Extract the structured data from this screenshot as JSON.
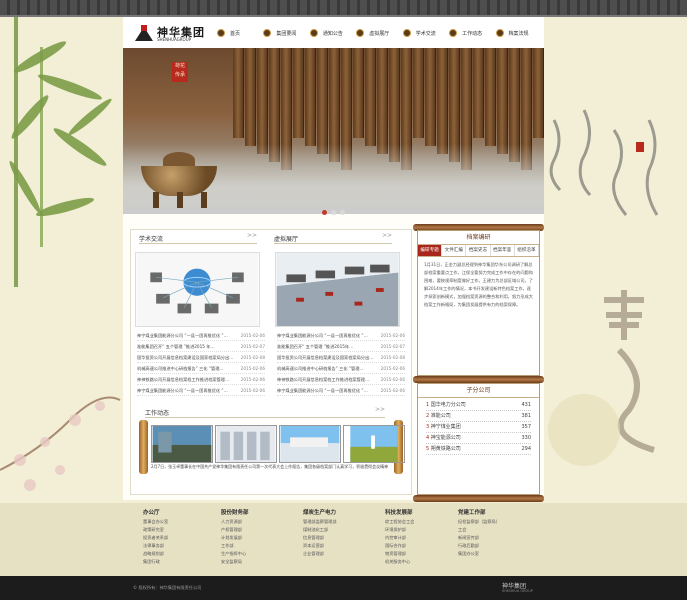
{
  "header": {
    "logo_name": "神华集团",
    "logo_sub": "SHENHUAGROUP",
    "nav": [
      "首页",
      "集团要闻",
      "通知公告",
      "虚拟展厅",
      "学术交流",
      "工作动态",
      "档案法规"
    ]
  },
  "banner": {
    "stamp": "荷花 传承",
    "slider_dots": 3,
    "active_dot": 0
  },
  "academic": {
    "title": "学术交流",
    "more": ">>",
    "items": [
      {
        "text": "神宁煤业集团能源分公司 “一县一团再推优化 ”…",
        "date": "2015-02-06"
      },
      {
        "text": "准能集团召开“ 五个管理 ”推进2015 年…",
        "date": "2015-02-07"
      },
      {
        "text": "国华投资公司开展信息档案建设及国家档案局分出…",
        "date": "2015-02-08"
      },
      {
        "text": "机械高速公司推进中心研档报告” 三化 “管理…",
        "date": "2015-02-06"
      },
      {
        "text": "神神铁路公司开展信息档案档工作推进档案管理…",
        "date": "2015-02-06"
      },
      {
        "text": "神宁煤业集团能源分公司 “一县一团再推优化 ”…",
        "date": "2015-02-06"
      }
    ]
  },
  "virtual": {
    "title": "虚拟展厅",
    "more": ">>",
    "items": [
      {
        "text": "神宁煤业集团能源分公司 “一县一团再推优化 ”…",
        "date": "2015-02-06"
      },
      {
        "text": "准能集团召开“ 五个管理 ”推进2015年…",
        "date": "2015-02-07"
      },
      {
        "text": "国华投资公司开展信息档案建设及国家档案局分出…",
        "date": "2015-02-08"
      },
      {
        "text": "机械高速公司推进中心研档报告” 三化 “管理…",
        "date": "2015-02-06"
      },
      {
        "text": "神神铁路公司开展信息档案档工作推进档案管理…",
        "date": "2015-02-06"
      },
      {
        "text": "神宁煤业集团能源分公司 “一县一团再推优化 ”…",
        "date": "2015-02-06"
      }
    ]
  },
  "work": {
    "title": "工作动态",
    "more": ">>",
    "caption": "2月7日，张玉卓董事长在中国共产党神华集团有限责任公司第一次代表大会上作报告，集团各级档案部门认真学习，积极贯彻会议精神"
  },
  "archive": {
    "title": "档案编研",
    "tabs": [
      "编研专题",
      "文件汇编",
      "档案史志",
      "档案年鉴",
      "组织沿革"
    ],
    "active_tab": 0,
    "text": "1月31日，正金力副总经理到神华集团华东公司调研了解总部档案重要点工作，江保全要努力完成工作中存在的问题和困难，要按规章制度做好工作。王建力为总部区域公司，了解2014年工作的情况，本书开发建设新特色档案工作，逐步探索创新模式，加强档案资源的整合和利用，努力形成大档案工作新格局，为集团发展提供有力的档案保障。"
  },
  "companies": {
    "title": "子分公司",
    "items": [
      {
        "n": "1",
        "name": "国华电力分公司",
        "count": "431"
      },
      {
        "n": "2",
        "name": "准能公司",
        "count": "381"
      },
      {
        "n": "3",
        "name": "神宁煤业集团",
        "count": "357"
      },
      {
        "n": "4",
        "name": "神宝能源公司",
        "count": "330"
      },
      {
        "n": "5",
        "name": "朔黄铁路公司",
        "count": "294"
      }
    ]
  },
  "footer": {
    "cols": [
      {
        "title": "办公厅",
        "items": [
          "董事会办公室",
          "政策研究室",
          "投资者关系部",
          "法律事务部",
          "战略规划部",
          "集团行政"
        ]
      },
      {
        "title": "股份财务部",
        "items": [
          "人力资源部",
          "产权管理部",
          "计划发展部",
          "工作部",
          "生产指挥中心",
          "安全监察局"
        ]
      },
      {
        "title": "煤炭生产电力",
        "items": [
          "管理部监察管理部",
          "煤制油化工部",
          "信息管理部",
          "资本运营部",
          "企业管理部"
        ]
      },
      {
        "title": "科技发展部",
        "items": [
          "综工程协会工会",
          "环境保护部",
          "内控审计部",
          "国际合作部",
          "物资管理部",
          "机关服务中心"
        ]
      },
      {
        "title": "党建工作部",
        "items": [
          "纪检监察部（监察局）",
          "工会",
          "新闻宣传部",
          "行政后勤部",
          "集团办公室"
        ]
      }
    ],
    "copyright": "© 版权所有：神华集团有限责任公司",
    "brand": "神华集团",
    "brand_sub": "SHENHUA GROUP"
  }
}
